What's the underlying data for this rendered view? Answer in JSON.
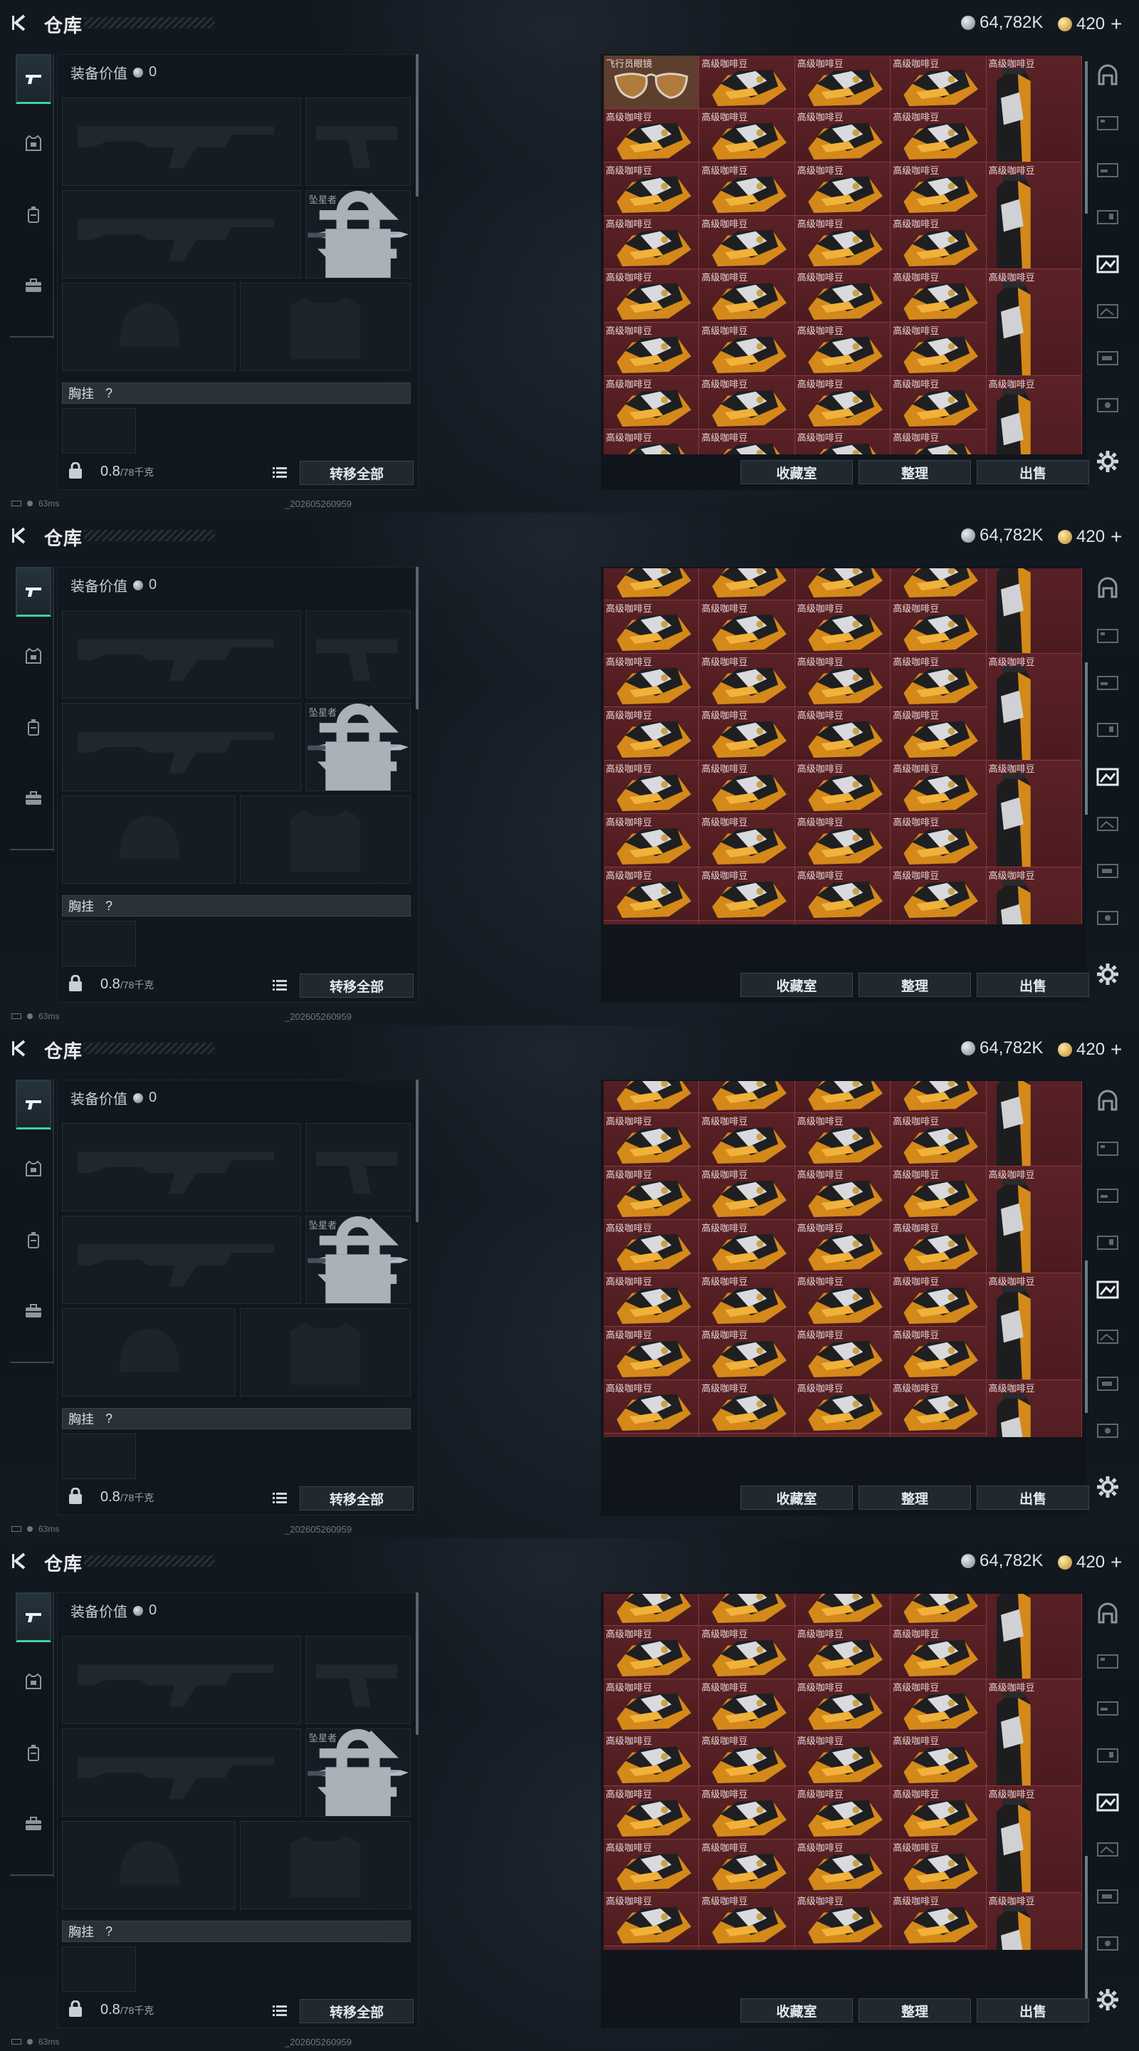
{
  "header": {
    "title": "仓库",
    "currency_silver": "64,782K",
    "currency_gold": "420"
  },
  "colors": {
    "accent_tab": "#3fd0a4",
    "stash_bg": "#551e22",
    "stash_border": "#8a3a3f"
  },
  "equipment": {
    "value_label": "装备价值",
    "value_amount": "0",
    "melee_name": "坠星者",
    "chest_label": "胸挂",
    "chest_hint": "?",
    "weight_current": "0.8",
    "weight_max": "/78千克",
    "transfer_all": "转移全部"
  },
  "stash": {
    "collection_button": "收藏室",
    "sort_button": "整理",
    "sell_button": "出售",
    "first_item_name": "飞行员眼镜",
    "item_name": "高级咖啡豆"
  },
  "status": {
    "ping": "63ms",
    "build_id": "_202605260959"
  },
  "icons": {
    "back": "back-arrow-icon",
    "left_tabs": [
      "gun-icon",
      "vest-icon",
      "backpack-icon",
      "toolbox-icon"
    ],
    "right_tabs": [
      "dome-icon",
      "stash-page-1-icon",
      "stash-page-2-icon",
      "stash-page-3-icon",
      "stash-page-4-icon",
      "stash-page-5-icon",
      "stash-page-6-icon",
      "stash-page-7-icon"
    ],
    "settings": "gear-icon"
  },
  "frames": [
    {
      "frame": 1,
      "first_row_special": true
    },
    {
      "frame": 2,
      "first_row_special": false
    },
    {
      "frame": 3,
      "first_row_special": false
    },
    {
      "frame": 4,
      "first_row_special": false
    }
  ]
}
